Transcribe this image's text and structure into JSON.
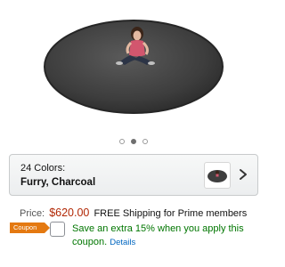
{
  "product_image": {
    "alt": "Charcoal round bean bag with person sitting on it"
  },
  "carousel": {
    "count": 3,
    "active_index": 1
  },
  "variant": {
    "count_label": "24 Colors:",
    "selected_name": "Furry, Charcoal"
  },
  "price": {
    "label": "Price:",
    "value": "$620.00",
    "shipping": "FREE Shipping for Prime members"
  },
  "coupon": {
    "badge": "Coupon",
    "text": "Save an extra 15% when you apply this coupon.",
    "details_link": "Details"
  },
  "colors": {
    "price": "#b12704",
    "coupon_badge": "#e47911",
    "coupon_text": "#007600",
    "link": "#0066c0"
  }
}
